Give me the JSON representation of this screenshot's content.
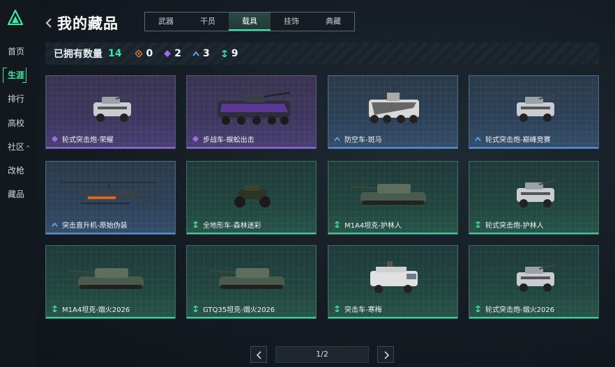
{
  "sidebar": {
    "items": [
      {
        "label": "首页",
        "active": false
      },
      {
        "label": "生涯",
        "active": true
      },
      {
        "label": "排行",
        "active": false
      },
      {
        "label": "高校",
        "active": false
      },
      {
        "label": "社区",
        "active": false,
        "has_dropdown": true
      },
      {
        "label": "改枪",
        "active": false
      },
      {
        "label": "藏品",
        "active": false
      }
    ]
  },
  "header": {
    "title": "我的藏品",
    "tabs": [
      {
        "label": "武器",
        "active": false
      },
      {
        "label": "干员",
        "active": false
      },
      {
        "label": "载具",
        "active": true
      },
      {
        "label": "挂饰",
        "active": false
      },
      {
        "label": "典藏",
        "active": false
      }
    ]
  },
  "summary": {
    "label": "已拥有数量",
    "total": "14",
    "rarities": [
      {
        "icon": "orange-diamond-icon",
        "color": "#e07a3a",
        "count": "0"
      },
      {
        "icon": "purple-diamond-icon",
        "color": "#9b6cf0",
        "count": "2"
      },
      {
        "icon": "blue-chevron-icon",
        "color": "#5fa3f0",
        "count": "3"
      },
      {
        "icon": "green-arrow-icon",
        "color": "#3ee6a3",
        "count": "9"
      }
    ]
  },
  "cards": [
    {
      "name": "轮式突击炮-荣耀",
      "rarity": "purple",
      "vehicle": "armored-car"
    },
    {
      "name": "步战车-蜈蚣出击",
      "rarity": "purple",
      "vehicle": "ifv"
    },
    {
      "name": "防空车-斑马",
      "rarity": "blue",
      "vehicle": "aa-truck"
    },
    {
      "name": "轮式突击炮-巅峰竞赛",
      "rarity": "blue",
      "vehicle": "armored-car"
    },
    {
      "name": "突击直升机-原始伪装",
      "rarity": "blue",
      "vehicle": "helicopter"
    },
    {
      "name": "全地形车-森林迷彩",
      "rarity": "green",
      "vehicle": "atv"
    },
    {
      "name": "M1A4坦克-护林人",
      "rarity": "green",
      "vehicle": "tank"
    },
    {
      "name": "轮式突击炮-护林人",
      "rarity": "green",
      "vehicle": "armored-car"
    },
    {
      "name": "M1A4坦克-烟火2026",
      "rarity": "green",
      "vehicle": "tank"
    },
    {
      "name": "GTQ35坦克-烟火2026",
      "rarity": "green",
      "vehicle": "tank"
    },
    {
      "name": "突击车-寒梅",
      "rarity": "green",
      "vehicle": "assault-truck"
    },
    {
      "name": "轮式突击炮-烟火2026",
      "rarity": "green",
      "vehicle": "armored-car"
    }
  ],
  "pagination": {
    "current": "1/2"
  },
  "colors": {
    "accent": "#3ee6a3"
  }
}
